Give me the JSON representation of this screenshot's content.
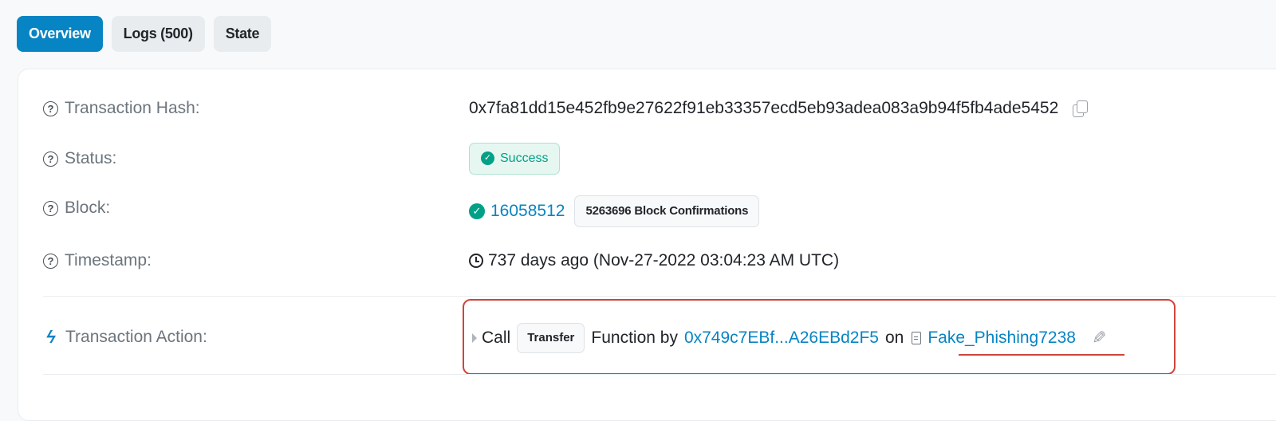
{
  "tabs": [
    {
      "label": "Overview",
      "active": true
    },
    {
      "label": "Logs (500)",
      "active": false
    },
    {
      "label": "State",
      "active": false
    }
  ],
  "overview": {
    "tx_hash_label": "Transaction Hash:",
    "tx_hash_value": "0x7fa81dd15e452fb9e27622f91eb33357ecd5eb93adea083a9b94f5fb4ade5452",
    "status_label": "Status:",
    "status_value": "Success",
    "block_label": "Block:",
    "block_number": "16058512",
    "block_confirmations": "5263696 Block Confirmations",
    "timestamp_label": "Timestamp:",
    "timestamp_value": "737 days ago (Nov-27-2022 03:04:23 AM UTC)",
    "action_label": "Transaction Action:",
    "action": {
      "call_text": "Call",
      "function_name": "Transfer",
      "function_by_text": "Function by",
      "from_address": "0x749c7EBf...A26EBd2F5",
      "on_text": "on",
      "contract_name": "Fake_Phishing7238"
    }
  },
  "colors": {
    "accent": "#0784c3",
    "success": "#00a186",
    "highlight": "#d0453a"
  },
  "icons": {
    "help": "question-circle-icon",
    "copy": "copy-icon",
    "success": "check-circle-icon",
    "clock": "clock-icon",
    "action": "lightning-icon",
    "expand": "caret-right-icon",
    "contract": "document-icon",
    "edit": "pencil-icon"
  }
}
